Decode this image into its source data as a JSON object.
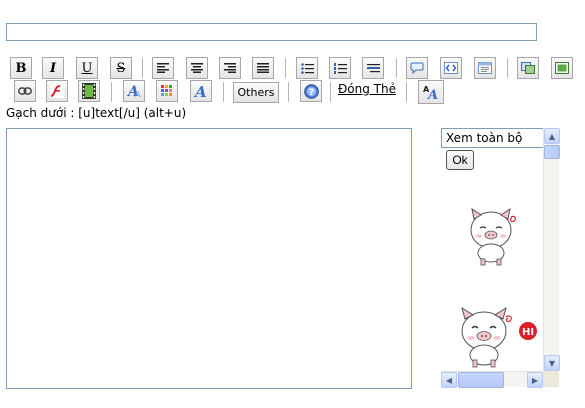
{
  "subject": {
    "value": ""
  },
  "toolbar": {
    "bold_glyph": "B",
    "italic_glyph": "I",
    "underline_glyph": "U",
    "strike_glyph": "S",
    "others_label": "Others",
    "close_tags_label": "Đóng Thẻ",
    "font_glyph": "A"
  },
  "hint": {
    "text": "Gạch dưới : [u]text[/u] (alt+u)"
  },
  "editor": {
    "value": ""
  },
  "smiley_panel": {
    "view_all_label": "Xem toàn bộ",
    "ok_label": "Ok",
    "hi_badge": "HI"
  },
  "icons": [
    "bold-icon",
    "italic-icon",
    "underline-icon",
    "strikethrough-icon",
    "align-left-icon",
    "align-center-icon",
    "align-right-icon",
    "align-justify-icon",
    "bullet-list-icon",
    "numbered-list-icon",
    "horizontal-rule-icon",
    "quote-icon",
    "code-icon",
    "html-icon",
    "image-icon",
    "picture-icon",
    "link-icon",
    "flash-icon",
    "video-icon",
    "font-style-icon",
    "color-palette-icon",
    "font-icon",
    "help-icon",
    "font-size-icon"
  ],
  "colors": {
    "border": "#7f9db9",
    "button_border": "#a7a6aa",
    "scroll_thumb": "#b4c8f6",
    "hi_badge": "#d9202b",
    "pig_pink": "#f5c4cb"
  }
}
